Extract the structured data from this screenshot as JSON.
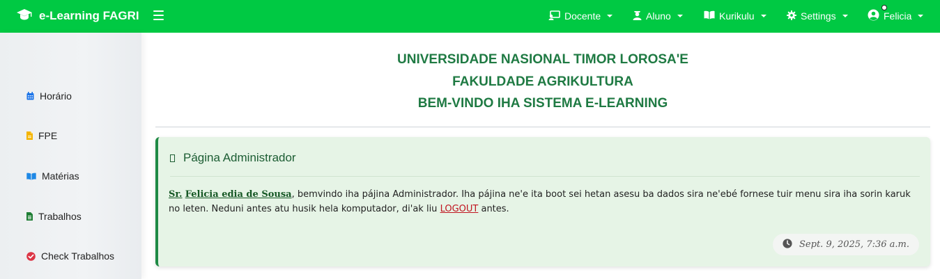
{
  "brand": {
    "title": "e-Learning FAGRI",
    "icon": "graduation-cap-icon"
  },
  "navbar": {
    "items": [
      {
        "label": "Docente",
        "icon": "chalkboard-teacher-icon"
      },
      {
        "label": "Aluno",
        "icon": "user-graduate-icon"
      },
      {
        "label": "Kurikulu",
        "icon": "book-open-icon"
      },
      {
        "label": "Settings",
        "icon": "gear-icon"
      },
      {
        "label": "Felicia",
        "icon": "user-circle-icon"
      }
    ]
  },
  "sidebar": {
    "items": [
      {
        "label": "Horário",
        "icon": "calendar-icon",
        "color": "#1a73e8"
      },
      {
        "label": "FPE",
        "icon": "file-icon",
        "color": "#f4b400"
      },
      {
        "label": "Matérias",
        "icon": "book-open-icon",
        "color": "#1e88e5"
      },
      {
        "label": "Trabalhos",
        "icon": "file-alt-icon",
        "color": "#1e7e34"
      },
      {
        "label": "Check Trabalhos",
        "icon": "check-circle-icon",
        "color": "#dc3545"
      }
    ]
  },
  "header": {
    "line1": "UNIVERSIDADE NASIONAL TIMOR LOROSA'E",
    "line2": "FAKULDADE AGRIKULTURA",
    "line3": "BEM-VINDO IHA SISTEMA E-LEARNING"
  },
  "card": {
    "title": "Página Administrador",
    "salutation": "Sr.",
    "user_name": "Felicia edia de Sousa",
    "message_1": ", bemvindo iha pájina Administrador. Iha pájina ne'e ita boot sei hetan asesu ba dados sira ne'ebé fornese tuir menu sira iha sorin karuk no leten. Neduni antes atu husik hela komputador, di'ak liu ",
    "logout_label": "LOGOUT",
    "message_2": " antes.",
    "timestamp": "Sept. 9, 2025, 7:36 a.m."
  },
  "colors": {
    "navbar": "#00c943",
    "title": "#1f7a43",
    "card_bg": "#e6f4e6",
    "card_border": "#1f8a45",
    "logout": "#c0141f"
  }
}
